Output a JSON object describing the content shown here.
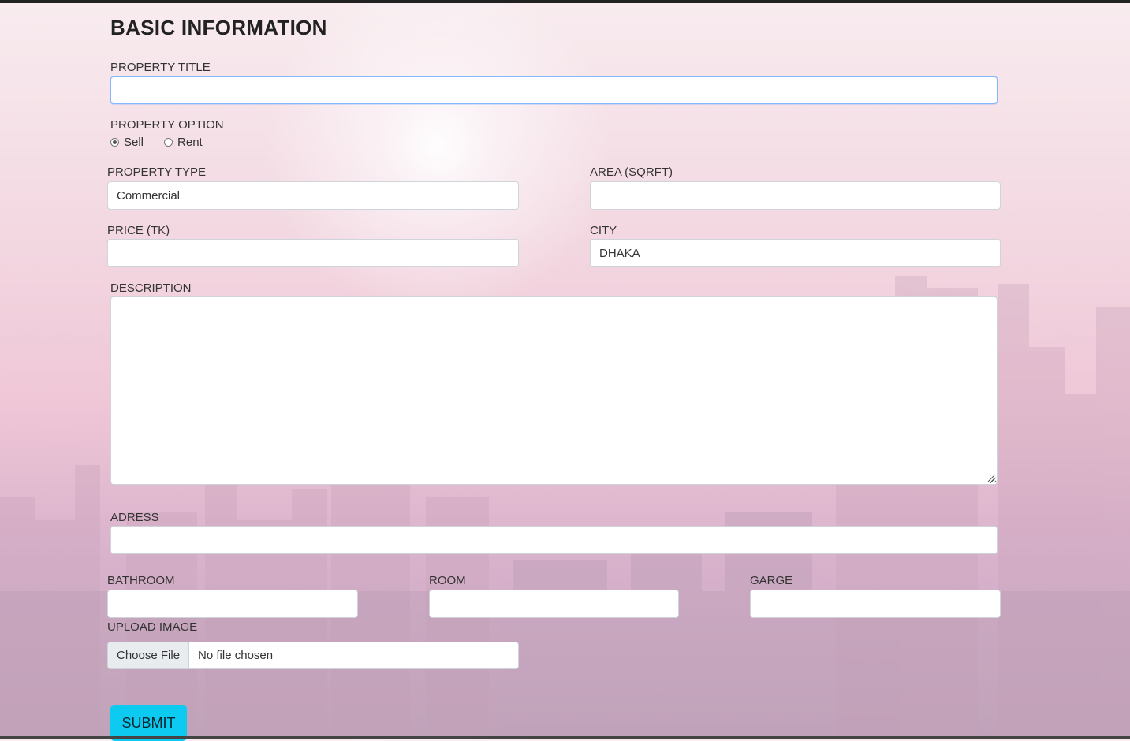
{
  "form": {
    "heading": "BASIC INFORMATION",
    "property_title": {
      "label": "PROPERTY TITLE",
      "value": ""
    },
    "property_option": {
      "label": "PROPERTY OPTION",
      "options": [
        "Sell",
        "Rent"
      ],
      "selected": "Sell"
    },
    "property_type": {
      "label": "PROPERTY TYPE",
      "value": "Commercial"
    },
    "area": {
      "label": "AREA (SQRFT)",
      "value": ""
    },
    "price": {
      "label": "PRICE (TK)",
      "value": ""
    },
    "city": {
      "label": "CITY",
      "value": "DHAKA"
    },
    "description": {
      "label": "DESCRIPTION",
      "value": ""
    },
    "address": {
      "label": "ADRESS",
      "value": ""
    },
    "bathroom": {
      "label": "BATHROOM",
      "value": ""
    },
    "room": {
      "label": "ROOM",
      "value": ""
    },
    "garage": {
      "label": "GARGE",
      "value": ""
    },
    "upload": {
      "label": "UPLOAD IMAGE",
      "button": "Choose File",
      "status": "No file chosen"
    },
    "submit_label": "SUBMIT"
  },
  "colors": {
    "accent": "#0dcaf0",
    "background_tint": "#efc6d6"
  }
}
